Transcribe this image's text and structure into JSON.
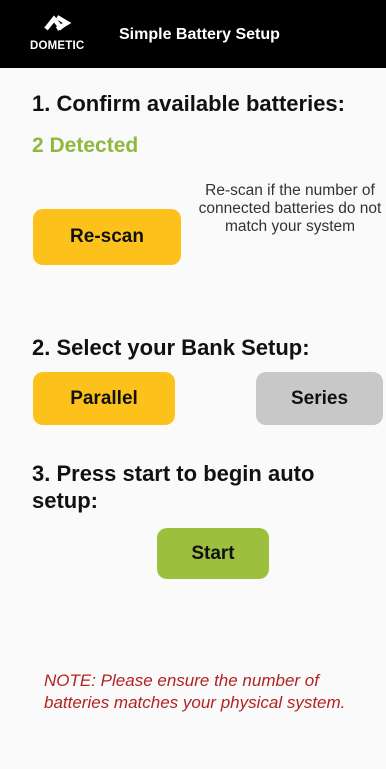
{
  "header": {
    "logo_text": "DOMETIC",
    "title": "Simple Battery Setup"
  },
  "step1": {
    "heading": "1. Confirm available batteries:",
    "detected": "2 Detected",
    "rescan_label": "Re-scan",
    "rescan_hint": "Re-scan if the number of connected batteries do not match your system"
  },
  "step2": {
    "heading": "2. Select your Bank Setup:",
    "parallel_label": "Parallel",
    "series_label": "Series",
    "selected": "Parallel"
  },
  "step3": {
    "heading": "3. Press start to begin auto setup:",
    "start_label": "Start"
  },
  "note": "NOTE: Please ensure the number of batteries matches your physical system.",
  "colors": {
    "header_bg": "#000000",
    "accent_yellow": "#fcc21b",
    "detected_green": "#8fb83e",
    "start_green": "#9dbf3e",
    "unselected_gray": "#c8c8c8",
    "note_red": "#b22222"
  }
}
